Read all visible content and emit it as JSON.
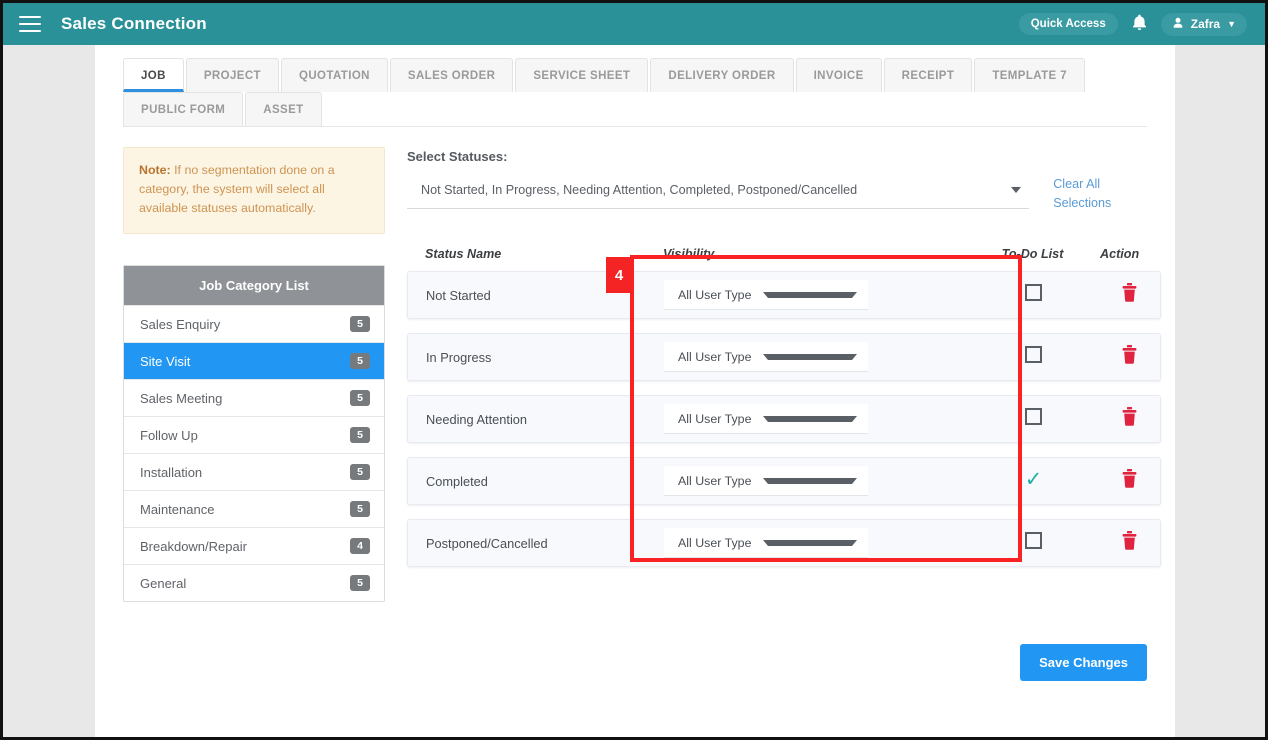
{
  "header": {
    "menu_icon": "hamburger-icon",
    "title": "Sales Connection",
    "quick_access_label": "Quick Access",
    "bell_icon": "bell-icon",
    "user_name": "Zafra",
    "user_icon": "person-icon",
    "caret_icon": "chevron-down-icon",
    "bar_color": "#2a9199"
  },
  "tabs": {
    "row1": [
      {
        "label": "JOB",
        "active": true
      },
      {
        "label": "PROJECT",
        "active": false
      },
      {
        "label": "QUOTATION",
        "active": false
      },
      {
        "label": "SALES ORDER",
        "active": false
      },
      {
        "label": "SERVICE SHEET",
        "active": false
      },
      {
        "label": "DELIVERY ORDER",
        "active": false
      },
      {
        "label": "INVOICE",
        "active": false
      },
      {
        "label": "RECEIPT",
        "active": false
      },
      {
        "label": "TEMPLATE 7",
        "active": false
      }
    ],
    "row2": [
      {
        "label": "PUBLIC FORM",
        "active": false
      },
      {
        "label": "ASSET",
        "active": false
      }
    ],
    "active_underline_color": "#2f8fe0"
  },
  "note": {
    "strong": "Note:",
    "text": " If no segmentation done on a category, the system will select all available statuses automatically.",
    "bg_color": "#fcf5e4",
    "text_color": "#cf9452"
  },
  "category_panel": {
    "title": "Job Category List",
    "header_color": "#8f9296",
    "active_color": "#2196f3",
    "items": [
      {
        "label": "Sales Enquiry",
        "count": "5",
        "active": false
      },
      {
        "label": "Site Visit",
        "count": "5",
        "active": true
      },
      {
        "label": "Sales Meeting",
        "count": "5",
        "active": false
      },
      {
        "label": "Follow Up",
        "count": "5",
        "active": false
      },
      {
        "label": "Installation",
        "count": "5",
        "active": false
      },
      {
        "label": "Maintenance",
        "count": "5",
        "active": false
      },
      {
        "label": "Breakdown/Repair",
        "count": "4",
        "active": false
      },
      {
        "label": "General",
        "count": "5",
        "active": false
      }
    ]
  },
  "select_statuses": {
    "label": "Select Statuses:",
    "value": "Not Started, In Progress, Needing Attention, Completed, Postponed/Cancelled",
    "dropdown_icon": "chevron-down-icon",
    "clear_all_label": "Clear All Selections",
    "clear_all_color": "#5b9bd5"
  },
  "status_table": {
    "columns": {
      "status_name": "Status Name",
      "visibility": "Visibility",
      "todo_list": "To-Do List",
      "action": "Action"
    },
    "rows": [
      {
        "status": "Not Started",
        "visibility": "All User Type",
        "todo_checked": false,
        "delete_icon": "trash-icon"
      },
      {
        "status": "In Progress",
        "visibility": "All User Type",
        "todo_checked": false,
        "delete_icon": "trash-icon"
      },
      {
        "status": "Needing Attention",
        "visibility": "All User Type",
        "todo_checked": false,
        "delete_icon": "trash-icon"
      },
      {
        "status": "Completed",
        "visibility": "All User Type",
        "todo_checked": true,
        "delete_icon": "trash-icon"
      },
      {
        "status": "Postponed/Cancelled",
        "visibility": "All User Type",
        "todo_checked": false,
        "delete_icon": "trash-icon"
      }
    ],
    "checked_color": "#22b0a4",
    "delete_color": "#e0243f"
  },
  "annotation": {
    "badge_number": "4",
    "color": "#fa2222"
  },
  "footer": {
    "save_label": "Save Changes",
    "save_color": "#2196f3"
  }
}
